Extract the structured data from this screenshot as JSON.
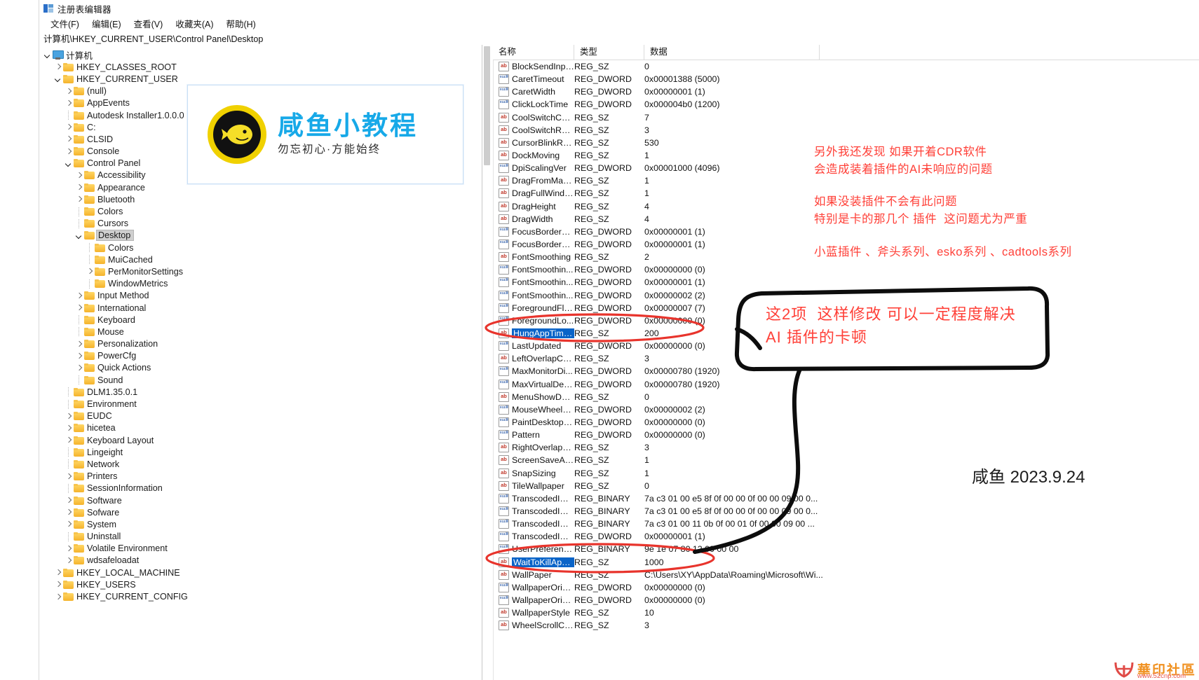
{
  "window": {
    "title": "注册表编辑器",
    "icon": "registry-editor-icon",
    "menu": [
      "文件(F)",
      "编辑(E)",
      "查看(V)",
      "收藏夹(A)",
      "帮助(H)"
    ],
    "address": "计算机\\HKEY_CURRENT_USER\\Control Panel\\Desktop"
  },
  "tree": {
    "root_label": "计算机",
    "items": [
      {
        "label": "计算机",
        "depth": 0,
        "state": "expanded",
        "icon": "computer-icon",
        "selected": false
      },
      {
        "label": "HKEY_CLASSES_ROOT",
        "depth": 1,
        "state": "collapsed",
        "icon": "folder-icon",
        "selected": false
      },
      {
        "label": "HKEY_CURRENT_USER",
        "depth": 1,
        "state": "expanded",
        "icon": "folder-icon",
        "selected": false
      },
      {
        "label": "(null)",
        "depth": 2,
        "state": "collapsed",
        "icon": "folder-icon",
        "selected": false
      },
      {
        "label": "AppEvents",
        "depth": 2,
        "state": "collapsed",
        "icon": "folder-icon",
        "selected": false
      },
      {
        "label": "Autodesk Installer1.0.0.0",
        "depth": 2,
        "state": "leaf",
        "icon": "folder-icon",
        "selected": false
      },
      {
        "label": "C:",
        "depth": 2,
        "state": "collapsed",
        "icon": "folder-icon",
        "selected": false
      },
      {
        "label": "CLSID",
        "depth": 2,
        "state": "collapsed",
        "icon": "folder-icon",
        "selected": false
      },
      {
        "label": "Console",
        "depth": 2,
        "state": "collapsed",
        "icon": "folder-icon",
        "selected": false
      },
      {
        "label": "Control Panel",
        "depth": 2,
        "state": "expanded",
        "icon": "folder-icon",
        "selected": false
      },
      {
        "label": "Accessibility",
        "depth": 3,
        "state": "collapsed",
        "icon": "folder-icon",
        "selected": false
      },
      {
        "label": "Appearance",
        "depth": 3,
        "state": "collapsed",
        "icon": "folder-icon",
        "selected": false
      },
      {
        "label": "Bluetooth",
        "depth": 3,
        "state": "collapsed",
        "icon": "folder-icon",
        "selected": false
      },
      {
        "label": "Colors",
        "depth": 3,
        "state": "leaf",
        "icon": "folder-icon",
        "selected": false
      },
      {
        "label": "Cursors",
        "depth": 3,
        "state": "leaf",
        "icon": "folder-icon",
        "selected": false
      },
      {
        "label": "Desktop",
        "depth": 3,
        "state": "expanded",
        "icon": "folder-icon",
        "selected": true
      },
      {
        "label": "Colors",
        "depth": 4,
        "state": "leaf",
        "icon": "folder-icon",
        "selected": false
      },
      {
        "label": "MuiCached",
        "depth": 4,
        "state": "leaf",
        "icon": "folder-icon",
        "selected": false
      },
      {
        "label": "PerMonitorSettings",
        "depth": 4,
        "state": "collapsed",
        "icon": "folder-icon",
        "selected": false
      },
      {
        "label": "WindowMetrics",
        "depth": 4,
        "state": "leaf",
        "icon": "folder-icon",
        "selected": false
      },
      {
        "label": "Input Method",
        "depth": 3,
        "state": "collapsed",
        "icon": "folder-icon",
        "selected": false
      },
      {
        "label": "International",
        "depth": 3,
        "state": "collapsed",
        "icon": "folder-icon",
        "selected": false
      },
      {
        "label": "Keyboard",
        "depth": 3,
        "state": "leaf",
        "icon": "folder-icon",
        "selected": false
      },
      {
        "label": "Mouse",
        "depth": 3,
        "state": "leaf",
        "icon": "folder-icon",
        "selected": false
      },
      {
        "label": "Personalization",
        "depth": 3,
        "state": "collapsed",
        "icon": "folder-icon",
        "selected": false
      },
      {
        "label": "PowerCfg",
        "depth": 3,
        "state": "collapsed",
        "icon": "folder-icon",
        "selected": false
      },
      {
        "label": "Quick Actions",
        "depth": 3,
        "state": "collapsed",
        "icon": "folder-icon",
        "selected": false
      },
      {
        "label": "Sound",
        "depth": 3,
        "state": "leaf",
        "icon": "folder-icon",
        "selected": false
      },
      {
        "label": "DLM1.35.0.1",
        "depth": 2,
        "state": "leaf",
        "icon": "folder-icon",
        "selected": false
      },
      {
        "label": "Environment",
        "depth": 2,
        "state": "leaf",
        "icon": "folder-icon",
        "selected": false
      },
      {
        "label": "EUDC",
        "depth": 2,
        "state": "collapsed",
        "icon": "folder-icon",
        "selected": false
      },
      {
        "label": "hicetea",
        "depth": 2,
        "state": "collapsed",
        "icon": "folder-icon",
        "selected": false
      },
      {
        "label": "Keyboard Layout",
        "depth": 2,
        "state": "collapsed",
        "icon": "folder-icon",
        "selected": false
      },
      {
        "label": "Lingeight",
        "depth": 2,
        "state": "leaf",
        "icon": "folder-icon",
        "selected": false
      },
      {
        "label": "Network",
        "depth": 2,
        "state": "leaf",
        "icon": "folder-icon",
        "selected": false
      },
      {
        "label": "Printers",
        "depth": 2,
        "state": "collapsed",
        "icon": "folder-icon",
        "selected": false
      },
      {
        "label": "SessionInformation",
        "depth": 2,
        "state": "leaf",
        "icon": "folder-icon",
        "selected": false
      },
      {
        "label": "Software",
        "depth": 2,
        "state": "collapsed",
        "icon": "folder-icon",
        "selected": false
      },
      {
        "label": "Sofware",
        "depth": 2,
        "state": "collapsed",
        "icon": "folder-icon",
        "selected": false
      },
      {
        "label": "System",
        "depth": 2,
        "state": "collapsed",
        "icon": "folder-icon",
        "selected": false
      },
      {
        "label": "Uninstall",
        "depth": 2,
        "state": "leaf",
        "icon": "folder-icon",
        "selected": false
      },
      {
        "label": "Volatile Environment",
        "depth": 2,
        "state": "collapsed",
        "icon": "folder-icon",
        "selected": false
      },
      {
        "label": "wdsafeloadat",
        "depth": 2,
        "state": "collapsed",
        "icon": "folder-icon",
        "selected": false
      },
      {
        "label": "HKEY_LOCAL_MACHINE",
        "depth": 1,
        "state": "collapsed",
        "icon": "folder-icon",
        "selected": false
      },
      {
        "label": "HKEY_USERS",
        "depth": 1,
        "state": "collapsed",
        "icon": "folder-icon",
        "selected": false
      },
      {
        "label": "HKEY_CURRENT_CONFIG",
        "depth": 1,
        "state": "collapsed",
        "icon": "folder-icon",
        "selected": false
      }
    ]
  },
  "list": {
    "columns": [
      "名称",
      "类型",
      "数据"
    ],
    "rows": [
      {
        "name": "BlockSendInpu...",
        "type": "REG_SZ",
        "data": "0",
        "icon": "string-value-icon",
        "selected": false
      },
      {
        "name": "CaretTimeout",
        "type": "REG_DWORD",
        "data": "0x00001388 (5000)",
        "icon": "binary-value-icon",
        "selected": false
      },
      {
        "name": "CaretWidth",
        "type": "REG_DWORD",
        "data": "0x00000001 (1)",
        "icon": "binary-value-icon",
        "selected": false
      },
      {
        "name": "ClickLockTime",
        "type": "REG_DWORD",
        "data": "0x000004b0 (1200)",
        "icon": "binary-value-icon",
        "selected": false
      },
      {
        "name": "CoolSwitchCol...",
        "type": "REG_SZ",
        "data": "7",
        "icon": "string-value-icon",
        "selected": false
      },
      {
        "name": "CoolSwitchRows",
        "type": "REG_SZ",
        "data": "3",
        "icon": "string-value-icon",
        "selected": false
      },
      {
        "name": "CursorBlinkRate",
        "type": "REG_SZ",
        "data": "530",
        "icon": "string-value-icon",
        "selected": false
      },
      {
        "name": "DockMoving",
        "type": "REG_SZ",
        "data": "1",
        "icon": "string-value-icon",
        "selected": false
      },
      {
        "name": "DpiScalingVer",
        "type": "REG_DWORD",
        "data": "0x00001000 (4096)",
        "icon": "binary-value-icon",
        "selected": false
      },
      {
        "name": "DragFromMaxi...",
        "type": "REG_SZ",
        "data": "1",
        "icon": "string-value-icon",
        "selected": false
      },
      {
        "name": "DragFullWindo...",
        "type": "REG_SZ",
        "data": "1",
        "icon": "string-value-icon",
        "selected": false
      },
      {
        "name": "DragHeight",
        "type": "REG_SZ",
        "data": "4",
        "icon": "string-value-icon",
        "selected": false
      },
      {
        "name": "DragWidth",
        "type": "REG_SZ",
        "data": "4",
        "icon": "string-value-icon",
        "selected": false
      },
      {
        "name": "FocusBorderH...",
        "type": "REG_DWORD",
        "data": "0x00000001 (1)",
        "icon": "binary-value-icon",
        "selected": false
      },
      {
        "name": "FocusBorderW...",
        "type": "REG_DWORD",
        "data": "0x00000001 (1)",
        "icon": "binary-value-icon",
        "selected": false
      },
      {
        "name": "FontSmoothing",
        "type": "REG_SZ",
        "data": "2",
        "icon": "string-value-icon",
        "selected": false
      },
      {
        "name": "FontSmoothin...",
        "type": "REG_DWORD",
        "data": "0x00000000 (0)",
        "icon": "binary-value-icon",
        "selected": false
      },
      {
        "name": "FontSmoothin...",
        "type": "REG_DWORD",
        "data": "0x00000001 (1)",
        "icon": "binary-value-icon",
        "selected": false
      },
      {
        "name": "FontSmoothin...",
        "type": "REG_DWORD",
        "data": "0x00000002 (2)",
        "icon": "binary-value-icon",
        "selected": false
      },
      {
        "name": "ForegroundFla...",
        "type": "REG_DWORD",
        "data": "0x00000007 (7)",
        "icon": "binary-value-icon",
        "selected": false
      },
      {
        "name": "ForegroundLo...",
        "type": "REG_DWORD",
        "data": "0x00000000 (0)",
        "icon": "binary-value-icon",
        "selected": false
      },
      {
        "name": "HungAppTime...",
        "type": "REG_SZ",
        "data": "200",
        "icon": "string-value-icon",
        "selected": true
      },
      {
        "name": "LastUpdated",
        "type": "REG_DWORD",
        "data": "0x00000000 (0)",
        "icon": "binary-value-icon",
        "selected": false
      },
      {
        "name": "LeftOverlapCh...",
        "type": "REG_SZ",
        "data": "3",
        "icon": "string-value-icon",
        "selected": false
      },
      {
        "name": "MaxMonitorDi...",
        "type": "REG_DWORD",
        "data": "0x00000780 (1920)",
        "icon": "binary-value-icon",
        "selected": false
      },
      {
        "name": "MaxVirtualDes...",
        "type": "REG_DWORD",
        "data": "0x00000780 (1920)",
        "icon": "binary-value-icon",
        "selected": false
      },
      {
        "name": "MenuShowDelay",
        "type": "REG_SZ",
        "data": "0",
        "icon": "string-value-icon",
        "selected": false
      },
      {
        "name": "MouseWheelR...",
        "type": "REG_DWORD",
        "data": "0x00000002 (2)",
        "icon": "binary-value-icon",
        "selected": false
      },
      {
        "name": "PaintDesktopV...",
        "type": "REG_DWORD",
        "data": "0x00000000 (0)",
        "icon": "binary-value-icon",
        "selected": false
      },
      {
        "name": "Pattern",
        "type": "REG_DWORD",
        "data": "0x00000000 (0)",
        "icon": "binary-value-icon",
        "selected": false
      },
      {
        "name": "RightOverlapC...",
        "type": "REG_SZ",
        "data": "3",
        "icon": "string-value-icon",
        "selected": false
      },
      {
        "name": "ScreenSaveActi...",
        "type": "REG_SZ",
        "data": "1",
        "icon": "string-value-icon",
        "selected": false
      },
      {
        "name": "SnapSizing",
        "type": "REG_SZ",
        "data": "1",
        "icon": "string-value-icon",
        "selected": false
      },
      {
        "name": "TileWallpaper",
        "type": "REG_SZ",
        "data": "0",
        "icon": "string-value-icon",
        "selected": false
      },
      {
        "name": "TranscodedIm...",
        "type": "REG_BINARY",
        "data": "7a c3 01 00 e5 8f 0f 00 00 0f 00 00 09 00 0...",
        "icon": "binary-value-icon",
        "selected": false
      },
      {
        "name": "TranscodedIm...",
        "type": "REG_BINARY",
        "data": "7a c3 01 00 e5 8f 0f 00 00 0f 00 00 09 00 0...",
        "icon": "binary-value-icon",
        "selected": false
      },
      {
        "name": "TranscodedIm...",
        "type": "REG_BINARY",
        "data": "7a c3 01 00 11 0b 0f 00 01 0f 00 00 09 00 ...",
        "icon": "binary-value-icon",
        "selected": false
      },
      {
        "name": "TranscodedIm...",
        "type": "REG_DWORD",
        "data": "0x00000001 (1)",
        "icon": "binary-value-icon",
        "selected": false
      },
      {
        "name": "UserPreferenc...",
        "type": "REG_BINARY",
        "data": "9e 1e 07 80 12 00 00 00",
        "icon": "binary-value-icon",
        "selected": false
      },
      {
        "name": "WaitToKillApp...",
        "type": "REG_SZ",
        "data": "1000",
        "icon": "string-value-icon",
        "selected": true
      },
      {
        "name": "WallPaper",
        "type": "REG_SZ",
        "data": "C:\\Users\\XY\\AppData\\Roaming\\Microsoft\\Wi...",
        "icon": "string-value-icon",
        "selected": false
      },
      {
        "name": "WallpaperOrig...",
        "type": "REG_DWORD",
        "data": "0x00000000 (0)",
        "icon": "binary-value-icon",
        "selected": false
      },
      {
        "name": "WallpaperOrig...",
        "type": "REG_DWORD",
        "data": "0x00000000 (0)",
        "icon": "binary-value-icon",
        "selected": false
      },
      {
        "name": "WallpaperStyle",
        "type": "REG_SZ",
        "data": "10",
        "icon": "string-value-icon",
        "selected": false
      },
      {
        "name": "WheelScrollCh...",
        "type": "REG_SZ",
        "data": "3",
        "icon": "string-value-icon",
        "selected": false
      }
    ]
  },
  "logo_card": {
    "title": "咸鱼小教程",
    "subtitle": "勿忘初心·方能始终",
    "icon": "fish-logo-icon",
    "accent_color": "#17a9e8",
    "badge_color": "#f0d100"
  },
  "annotations": {
    "color": "#ff4038",
    "note1": "另外我还发现 如果开着CDR软件\n会造成装着插件的AI未响应的问题",
    "note2": "如果没装插件不会有此问题\n特别是卡的那几个 插件  这问题尤为严重",
    "note3": "小蓝插件 、斧头系列、esko系列 、cadtools系列",
    "boxed_note": "这2项  这样修改 可以一定程度解决\nAI 插件的卡顿",
    "signature": "咸鱼  2023.9.24"
  },
  "watermark": {
    "text": "華印社區",
    "url": "www.52cnp.com",
    "icon": "huayin-logo-icon",
    "color": "#f0901e"
  }
}
